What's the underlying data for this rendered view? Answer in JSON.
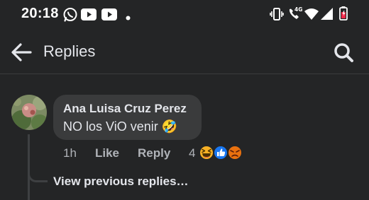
{
  "status_bar": {
    "time": "20:18",
    "left_icons": [
      "whatsapp-icon",
      "youtube-icon",
      "youtube-icon",
      "notification-dot-icon"
    ],
    "right_icons": [
      "vibrate-icon",
      "volte-call-icon",
      "wifi-icon",
      "signal-icon",
      "battery-icon"
    ],
    "network_label": "4G"
  },
  "header": {
    "title": "Replies",
    "back_icon": "arrow-left-icon",
    "search_icon": "search-icon"
  },
  "comment": {
    "author": "Ana Luisa Cruz Perez",
    "text": "NO los ViO venir 🤣",
    "time": "1h",
    "like_label": "Like",
    "reply_label": "Reply",
    "reaction_count": "4",
    "reactions": [
      "haha",
      "like",
      "angry"
    ]
  },
  "view_previous_label": "View previous replies…",
  "colors": {
    "background": "#242526",
    "bubble": "#3a3b3c",
    "text_primary": "#e4e6eb",
    "text_secondary": "#b0b3b8",
    "like_blue": "#1877f2",
    "battery_red": "#f02849"
  }
}
